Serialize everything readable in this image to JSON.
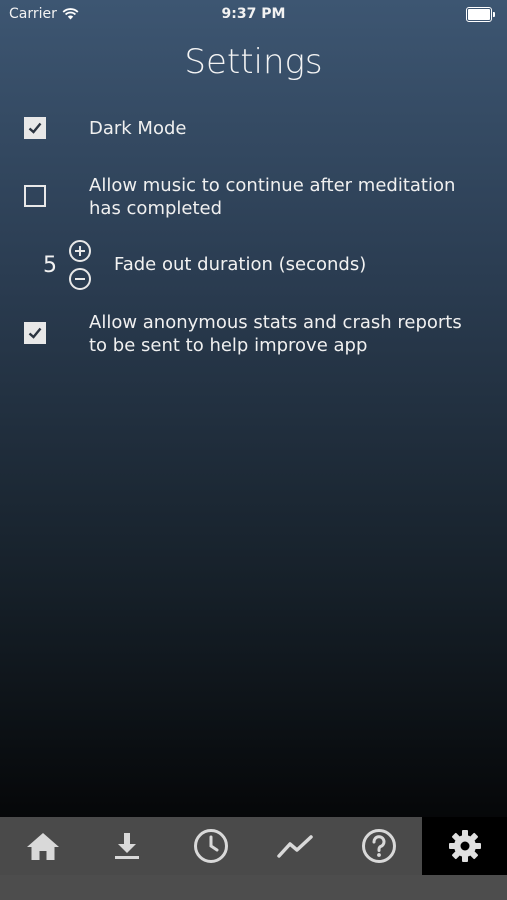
{
  "status_bar": {
    "carrier": "Carrier",
    "time": "9:37 PM"
  },
  "page": {
    "title": "Settings"
  },
  "settings": {
    "dark_mode": {
      "label": "Dark Mode",
      "checked": true
    },
    "allow_music": {
      "label_line1": "Allow music to continue after meditation",
      "label_line2": "has completed",
      "checked": false
    },
    "fade_out": {
      "value": "5",
      "label": "Fade out duration (seconds)"
    },
    "anonymous_stats": {
      "label_line1": "Allow anonymous stats and crash reports",
      "label_line2": "to be sent to help improve app",
      "checked": true
    }
  },
  "tab_bar": {
    "tabs": [
      {
        "icon": "home-icon"
      },
      {
        "icon": "download-icon"
      },
      {
        "icon": "clock-icon"
      },
      {
        "icon": "trend-icon"
      },
      {
        "icon": "help-icon"
      },
      {
        "icon": "gear-icon",
        "active": true
      }
    ]
  },
  "colors": {
    "tab_bar": "#4a4a4a",
    "icon": "#d9d9d9",
    "active_tab": "#000000"
  }
}
